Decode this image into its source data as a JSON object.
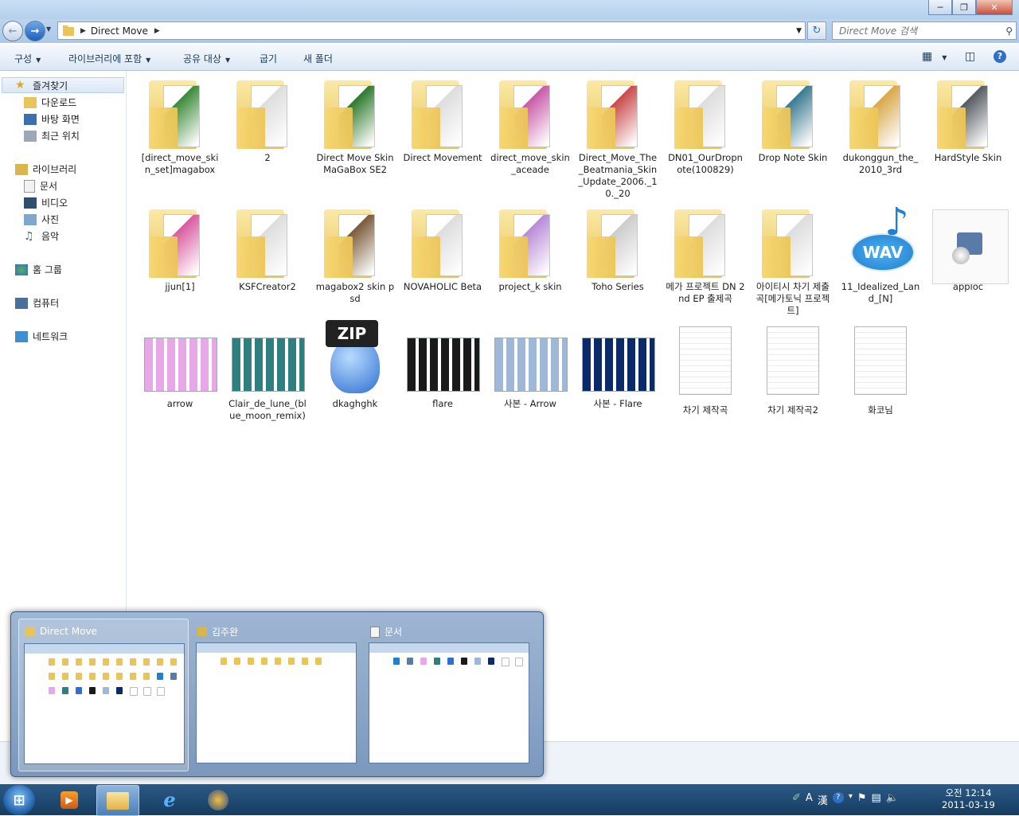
{
  "window": {
    "title": "Direct Move",
    "controls": [
      "─",
      "❐",
      "✕"
    ]
  },
  "address": {
    "path": [
      "Direct Move"
    ],
    "search_placeholder": "Direct Move 검색"
  },
  "toolbar": {
    "organize": "구성",
    "include_library": "라이브러리에 포함",
    "share": "공유 대상",
    "burn": "굽기",
    "new_folder": "새 폴더"
  },
  "navpane": {
    "favorites": "즐겨찾기",
    "downloads": "다운로드",
    "desktop": "바탕 화면",
    "recent": "최근 위치",
    "libraries": "라이브러리",
    "documents": "문서",
    "videos": "비디오",
    "pictures": "사진",
    "music": "음악",
    "homegroup": "홈 그룹",
    "computer": "컴퓨터",
    "network": "네트워크"
  },
  "items": [
    {
      "label": "[direct_move_skin_set]magabox",
      "kind": "folder",
      "color": "#3a8a3a"
    },
    {
      "label": "2",
      "kind": "folder",
      "color": "#dddddd"
    },
    {
      "label": "Direct Move Skin MaGaBox SE2",
      "kind": "folder",
      "color": "#2d7a2d"
    },
    {
      "label": "Direct Movement",
      "kind": "folder",
      "color": "#dddddd"
    },
    {
      "label": "direct_move_skin_aceade",
      "kind": "folder",
      "color": "#c85aa8"
    },
    {
      "label": "Direct_Move_The_Beatmania_Skin_Update_2006._10._20",
      "kind": "folder",
      "color": "#c84a4a"
    },
    {
      "label": "DN01_OurDropnote(100829)",
      "kind": "folder",
      "color": "#dddddd"
    },
    {
      "label": "Drop Note Skin",
      "kind": "folder",
      "color": "#3a7a90"
    },
    {
      "label": "dukonggun_the_2010_3rd",
      "kind": "folder",
      "color": "#d8a848"
    },
    {
      "label": "HardStyle Skin",
      "kind": "folder",
      "color": "#555a60"
    },
    {
      "label": "jjun[1]",
      "kind": "folder",
      "color": "#d85aa0"
    },
    {
      "label": "KSFCreator2",
      "kind": "folder",
      "color": "#dddddd"
    },
    {
      "label": "magabox2 skin psd",
      "kind": "folder",
      "color": "#7a5a3a"
    },
    {
      "label": "NOVAHOLIC Beta",
      "kind": "folder",
      "color": "#dddddd"
    },
    {
      "label": "project_k skin",
      "kind": "folder",
      "color": "#b88ad8"
    },
    {
      "label": "Toho Series",
      "kind": "folder",
      "color": "#cccccc"
    },
    {
      "label": "메가 프로젝트 DN 2nd EP 출제곡",
      "kind": "folder",
      "color": "#dddddd"
    },
    {
      "label": "아이티시 차기 제출곡[메가토닉 프로젝트]",
      "kind": "folder",
      "color": "#dddddd"
    },
    {
      "label": "11_Idealized_Land_[N]",
      "kind": "wav",
      "color": "#1f7fd0"
    },
    {
      "label": "apploc",
      "kind": "app",
      "color": "#5a7aa8"
    },
    {
      "label": "arrow",
      "kind": "image",
      "color": "#e8a8e8"
    },
    {
      "label": "Clair_de_lune_(blue_moon_remix)",
      "kind": "image",
      "color": "#2f7f80"
    },
    {
      "label": "dkaghghk",
      "kind": "zip",
      "color": "#2f6fd0"
    },
    {
      "label": "flare",
      "kind": "image",
      "color": "#1a1a1a"
    },
    {
      "label": "사본 - Arrow",
      "kind": "image",
      "color": "#9fb8d8"
    },
    {
      "label": "사본 - Flare",
      "kind": "image",
      "color": "#0a2a6a"
    },
    {
      "label": "차기 제작곡",
      "kind": "doc",
      "color": "#ffffff"
    },
    {
      "label": "차기 제작곡2",
      "kind": "doc",
      "color": "#ffffff"
    },
    {
      "label": "화코님",
      "kind": "doc",
      "color": "#ffffff"
    }
  ],
  "peek": {
    "windows": [
      {
        "title": "Direct Move"
      },
      {
        "title": "김주완"
      },
      {
        "title": "문서"
      }
    ]
  },
  "taskbar": {
    "start": "⊞",
    "ime_a": "A",
    "ime_han": "漢",
    "clock_time": "오전 12:14",
    "clock_date": "2011-03-19"
  }
}
